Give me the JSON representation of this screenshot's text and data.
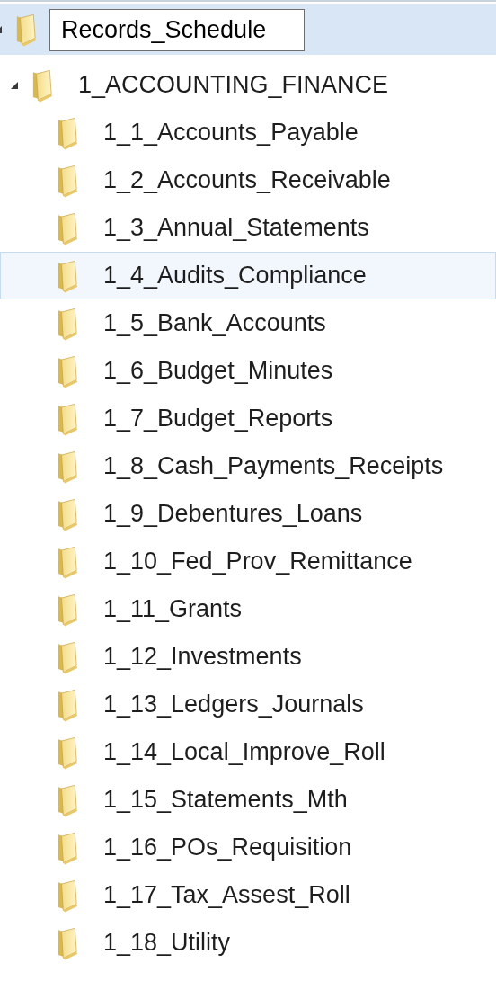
{
  "tree": {
    "label": "Records_Schedule",
    "renaming": true,
    "selected": true,
    "expanded": true,
    "children": [
      {
        "label": "1_ACCOUNTING_FINANCE",
        "selected": false,
        "expanded": true,
        "children": [
          {
            "label": "1_1_Accounts_Payable",
            "selected": false
          },
          {
            "label": "1_2_Accounts_Receivable",
            "selected": false
          },
          {
            "label": "1_3_Annual_Statements",
            "selected": false
          },
          {
            "label": "1_4_Audits_Compliance",
            "selected": true
          },
          {
            "label": "1_5_Bank_Accounts",
            "selected": false
          },
          {
            "label": "1_6_Budget_Minutes",
            "selected": false
          },
          {
            "label": "1_7_Budget_Reports",
            "selected": false
          },
          {
            "label": "1_8_Cash_Payments_Receipts",
            "selected": false
          },
          {
            "label": "1_9_Debentures_Loans",
            "selected": false
          },
          {
            "label": "1_10_Fed_Prov_Remittance",
            "selected": false
          },
          {
            "label": "1_11_Grants",
            "selected": false
          },
          {
            "label": "1_12_Investments",
            "selected": false
          },
          {
            "label": "1_13_Ledgers_Journals",
            "selected": false
          },
          {
            "label": "1_14_Local_Improve_Roll",
            "selected": false
          },
          {
            "label": "1_15_Statements_Mth",
            "selected": false
          },
          {
            "label": "1_16_POs_Requisition",
            "selected": false
          },
          {
            "label": "1_17_Tax_Assest_Roll",
            "selected": false
          },
          {
            "label": "1_18_Utility",
            "selected": false
          }
        ]
      }
    ]
  }
}
